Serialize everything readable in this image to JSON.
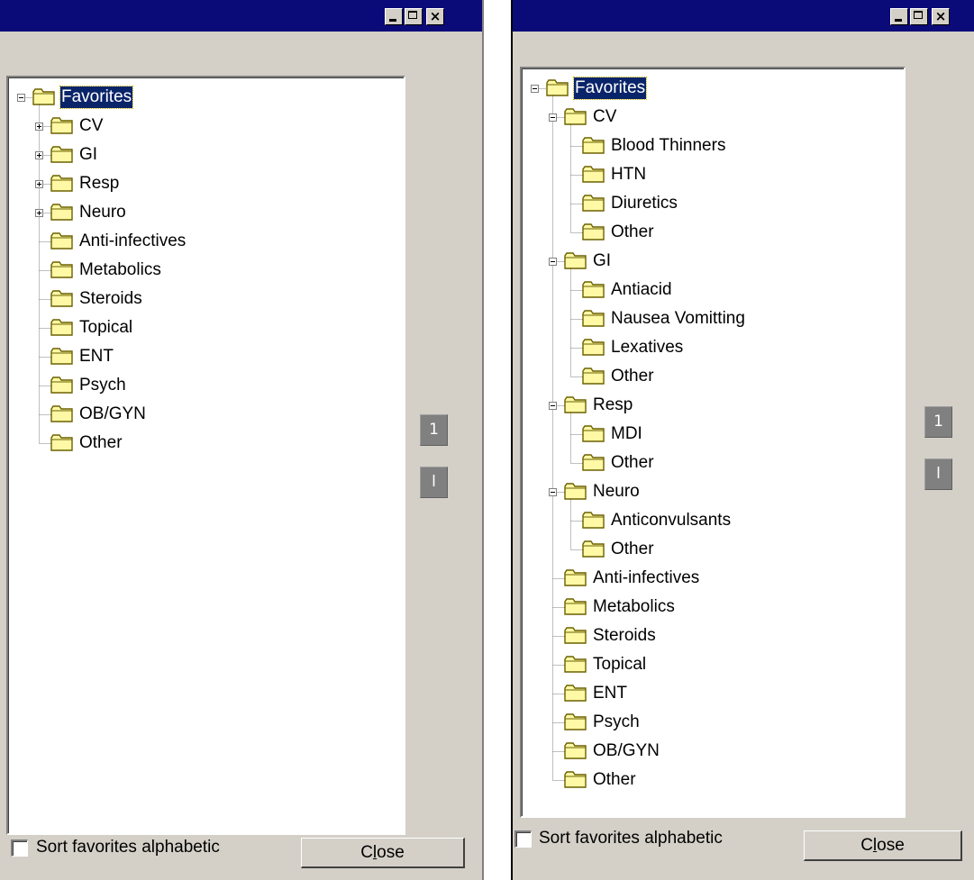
{
  "window_controls": {
    "minimize_icon": "minimize-icon",
    "maximize_icon": "maximize-icon",
    "close_glyph": "×"
  },
  "colors": {
    "titlebar": "#0a0a78",
    "face": "#d4d0c8",
    "selection": "#0a246a",
    "folder_fill": "#fff9a6",
    "folder_stroke": "#6b6100",
    "tree_line": "#808080"
  },
  "panels": [
    {
      "id": "collapsed",
      "tree": [
        {
          "label": "Favorites",
          "selected": true,
          "expanded": true,
          "children": [
            {
              "label": "CV",
              "expanded": false,
              "has_children": true
            },
            {
              "label": "GI",
              "expanded": false,
              "has_children": true
            },
            {
              "label": "Resp",
              "expanded": false,
              "has_children": true
            },
            {
              "label": "Neuro",
              "expanded": false,
              "has_children": true
            },
            {
              "label": "Anti-infectives"
            },
            {
              "label": "Metabolics"
            },
            {
              "label": "Steroids"
            },
            {
              "label": "Topical"
            },
            {
              "label": "ENT"
            },
            {
              "label": "Psych"
            },
            {
              "label": "OB/GYN"
            },
            {
              "label": "Other"
            }
          ]
        }
      ],
      "move_up_label": "1",
      "move_down_label": "l",
      "sort_checkbox": {
        "label": "Sort favorites alphabetic",
        "checked": false
      },
      "close_button": {
        "label_pre": "C",
        "label_accel": "l",
        "label_post": "ose"
      }
    },
    {
      "id": "expanded",
      "tree": [
        {
          "label": "Favorites",
          "selected": true,
          "expanded": true,
          "children": [
            {
              "label": "CV",
              "expanded": true,
              "children": [
                {
                  "label": "Blood Thinners"
                },
                {
                  "label": "HTN"
                },
                {
                  "label": "Diuretics"
                },
                {
                  "label": "Other"
                }
              ]
            },
            {
              "label": "GI",
              "expanded": true,
              "children": [
                {
                  "label": "Antiacid"
                },
                {
                  "label": "Nausea Vomitting"
                },
                {
                  "label": "Lexatives"
                },
                {
                  "label": "Other"
                }
              ]
            },
            {
              "label": "Resp",
              "expanded": true,
              "children": [
                {
                  "label": "MDI"
                },
                {
                  "label": "Other"
                }
              ]
            },
            {
              "label": "Neuro",
              "expanded": true,
              "children": [
                {
                  "label": "Anticonvulsants"
                },
                {
                  "label": "Other"
                }
              ]
            },
            {
              "label": "Anti-infectives"
            },
            {
              "label": "Metabolics"
            },
            {
              "label": "Steroids"
            },
            {
              "label": "Topical"
            },
            {
              "label": "ENT"
            },
            {
              "label": "Psych"
            },
            {
              "label": "OB/GYN"
            },
            {
              "label": "Other"
            }
          ]
        }
      ],
      "move_up_label": "1",
      "move_down_label": "l",
      "sort_checkbox": {
        "label": "Sort favorites alphabetic",
        "checked": false
      },
      "close_button": {
        "label_pre": "C",
        "label_accel": "l",
        "label_post": "ose"
      }
    }
  ]
}
